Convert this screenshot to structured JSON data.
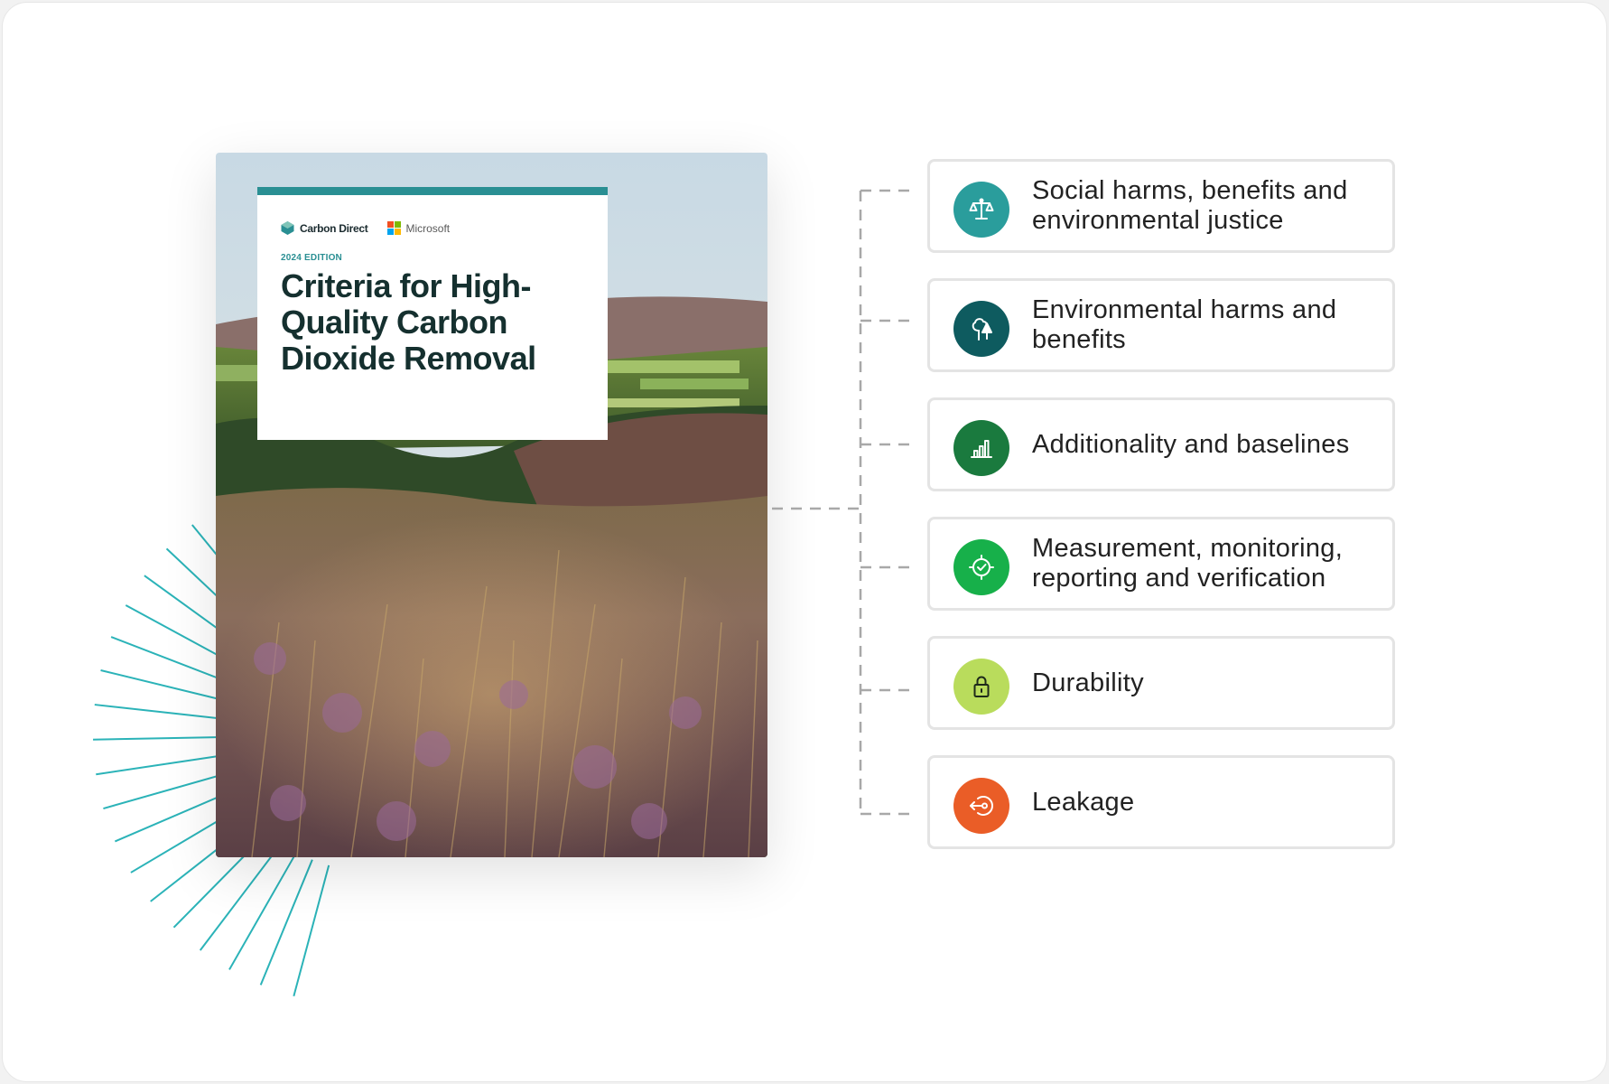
{
  "cover": {
    "brand_left": "Carbon Direct",
    "brand_right": "Microsoft",
    "edition": "2024 EDITION",
    "title": "Criteria for High-Quality Carbon Dioxide Removal"
  },
  "criteria": [
    {
      "label": "Social harms, benefits and environmental justice",
      "icon": "justice-scale-icon",
      "color": "#2a9d9c"
    },
    {
      "label": "Environmental harms and benefits",
      "icon": "tree-icon",
      "color": "#0e5b5f"
    },
    {
      "label": "Additionality and baselines",
      "icon": "bar-chart-icon",
      "color": "#1a7a3e"
    },
    {
      "label": "Measurement, monitoring, reporting and verification",
      "icon": "target-check-icon",
      "color": "#17b04a"
    },
    {
      "label": "Durability",
      "icon": "lock-icon",
      "color": "#b9dc5c"
    },
    {
      "label": "Leakage",
      "icon": "exit-icon",
      "color": "#ea5d27"
    }
  ],
  "colors": {
    "accent": "#2a8f93",
    "title_text": "#15302f",
    "burst_lines": "#2bb3b8",
    "connector": "#a8a8a8"
  }
}
